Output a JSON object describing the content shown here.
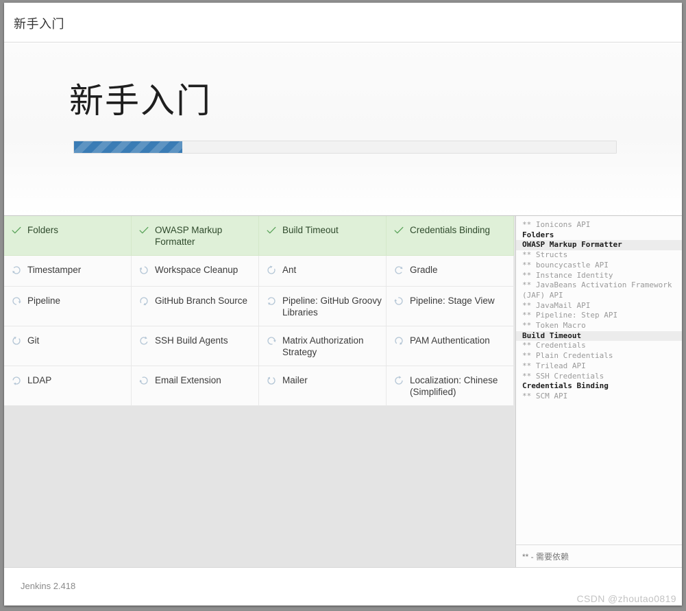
{
  "window": {
    "header_title": "新手入门",
    "hero_title": "新手入门"
  },
  "progress": {
    "percent": 20,
    "fill_color": "#3a7cb5",
    "track_color": "#f2f2f2"
  },
  "colors": {
    "done_background": "#dff0d8",
    "check_green": "#5aa35a",
    "spinner_blue": "#b4c6d6",
    "page_background": "#e4e4e4"
  },
  "plugins": [
    {
      "name": "Folders",
      "status": "done",
      "icon": "check-icon"
    },
    {
      "name": "OWASP Markup Formatter",
      "status": "done",
      "icon": "check-icon"
    },
    {
      "name": "Build Timeout",
      "status": "done",
      "icon": "check-icon"
    },
    {
      "name": "Credentials Binding",
      "status": "done",
      "icon": "check-icon"
    },
    {
      "name": "Timestamper",
      "status": "pending",
      "icon": "spinner-icon"
    },
    {
      "name": "Workspace Cleanup",
      "status": "pending",
      "icon": "spinner-icon"
    },
    {
      "name": "Ant",
      "status": "pending",
      "icon": "spinner-icon"
    },
    {
      "name": "Gradle",
      "status": "pending",
      "icon": "spinner-icon"
    },
    {
      "name": "Pipeline",
      "status": "pending",
      "icon": "spinner-icon"
    },
    {
      "name": "GitHub Branch Source",
      "status": "pending",
      "icon": "spinner-icon"
    },
    {
      "name": "Pipeline: GitHub Groovy Libraries",
      "status": "pending",
      "icon": "spinner-icon"
    },
    {
      "name": "Pipeline: Stage View",
      "status": "pending",
      "icon": "spinner-icon"
    },
    {
      "name": "Git",
      "status": "pending",
      "icon": "spinner-icon"
    },
    {
      "name": "SSH Build Agents",
      "status": "pending",
      "icon": "spinner-icon"
    },
    {
      "name": "Matrix Authorization Strategy",
      "status": "pending",
      "icon": "spinner-icon"
    },
    {
      "name": "PAM Authentication",
      "status": "pending",
      "icon": "spinner-icon"
    },
    {
      "name": "LDAP",
      "status": "pending",
      "icon": "spinner-icon"
    },
    {
      "name": "Email Extension",
      "status": "pending",
      "icon": "spinner-icon"
    },
    {
      "name": "Mailer",
      "status": "pending",
      "icon": "spinner-icon"
    },
    {
      "name": "Localization: Chinese (Simplified)",
      "status": "pending",
      "icon": "spinner-icon"
    }
  ],
  "log": {
    "lines": [
      {
        "text": "** Ionicons API",
        "kind": "dependency"
      },
      {
        "text": "Folders",
        "kind": "main"
      },
      {
        "text": "OWASP Markup Formatter",
        "kind": "main",
        "highlighted": true
      },
      {
        "text": "** Structs",
        "kind": "dependency"
      },
      {
        "text": "** bouncycastle API",
        "kind": "dependency"
      },
      {
        "text": "** Instance Identity",
        "kind": "dependency"
      },
      {
        "text": "** JavaBeans Activation Framework (JAF) API",
        "kind": "dependency"
      },
      {
        "text": "** JavaMail API",
        "kind": "dependency"
      },
      {
        "text": "** Pipeline: Step API",
        "kind": "dependency"
      },
      {
        "text": "** Token Macro",
        "kind": "dependency"
      },
      {
        "text": "Build Timeout",
        "kind": "main",
        "highlighted": true
      },
      {
        "text": "** Credentials",
        "kind": "dependency"
      },
      {
        "text": "** Plain Credentials",
        "kind": "dependency"
      },
      {
        "text": "** Trilead API",
        "kind": "dependency"
      },
      {
        "text": "** SSH Credentials",
        "kind": "dependency"
      },
      {
        "text": "Credentials Binding",
        "kind": "main"
      },
      {
        "text": "** SCM API",
        "kind": "dependency"
      }
    ],
    "legend": "** - 需要依赖"
  },
  "footer": {
    "version": "Jenkins 2.418",
    "watermark": "CSDN @zhoutao0819"
  }
}
